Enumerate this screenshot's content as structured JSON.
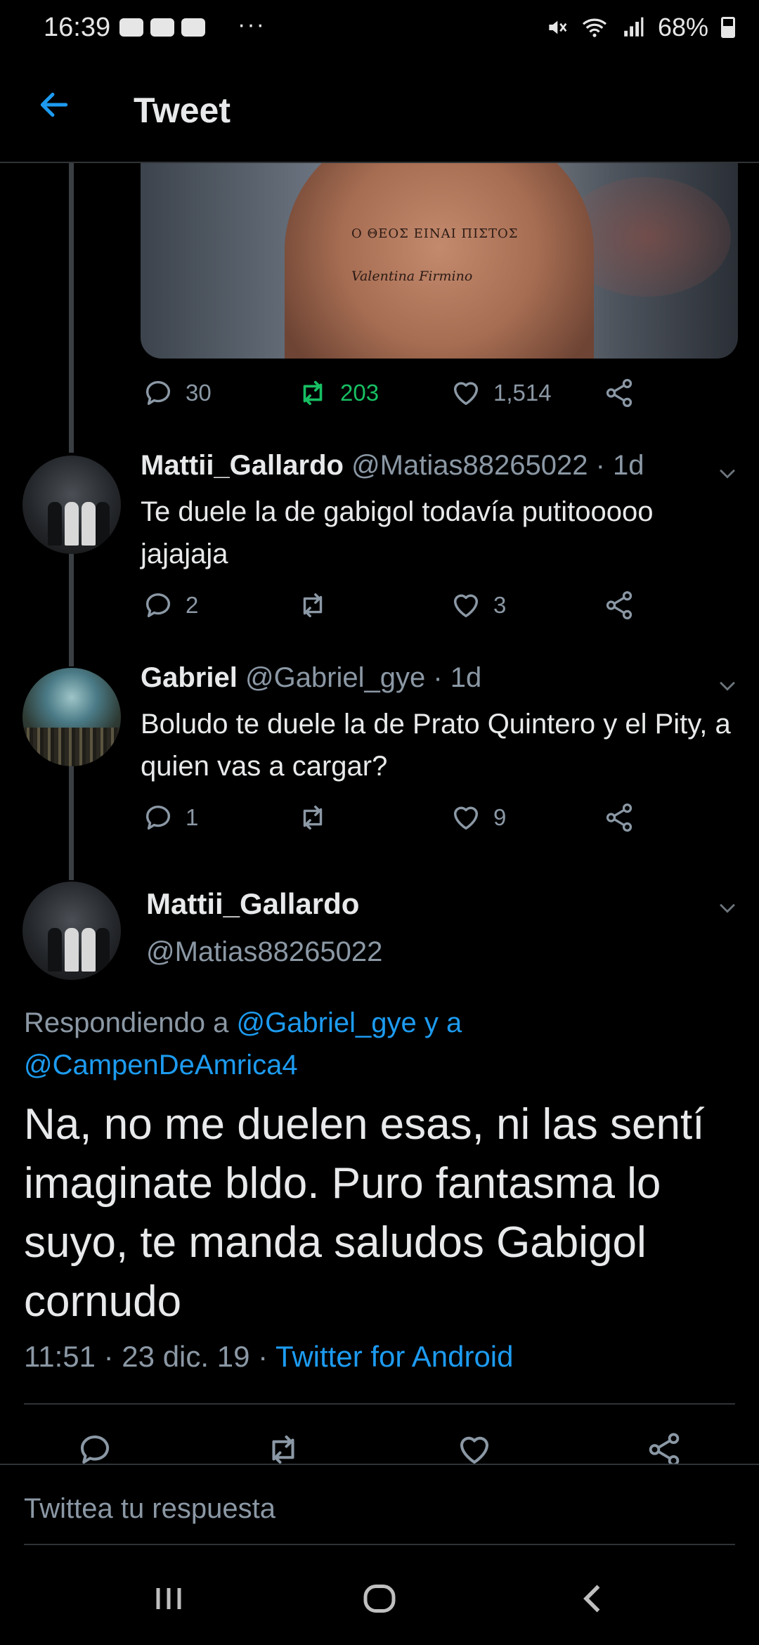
{
  "status_bar": {
    "time": "16:39",
    "more": "···",
    "battery": "68%",
    "icons": [
      "download-icon",
      "youtube-icon",
      "youtube-icon",
      "mute-icon",
      "wifi-icon",
      "signal-icon",
      "battery-icon"
    ]
  },
  "header": {
    "title": "Tweet",
    "back_icon": "arrow-left-icon"
  },
  "image_tweet": {
    "image_text_line1": "Ο ΘΕΟΣ ΕΙΝΑΙ ΠΙΣΤΟΣ",
    "image_text_line2": "Valentina Firmino",
    "actions": {
      "replies": "30",
      "retweets": "203",
      "likes": "1,514"
    }
  },
  "replies": [
    {
      "name": "Mattii_Gallardo",
      "meta": "@Matias88265022 · 1d",
      "text": "Te duele la de gabigol todavía putitooooo jajajaja",
      "replies": "2",
      "retweets": "",
      "likes": "3"
    },
    {
      "name": "Gabriel",
      "meta": "@Gabriel_gye · 1d",
      "text": "Boludo te duele la de Prato Quintero y el Pity, a quien vas a cargar?",
      "replies": "1",
      "retweets": "",
      "likes": "9"
    }
  ],
  "main_tweet": {
    "name": "Mattii_Gallardo",
    "handle": "@Matias88265022",
    "replying_prefix": "Respondiendo a ",
    "replying_mention1": "@Gabriel_gye y a",
    "replying_mention2": "@CampenDeAmrica4",
    "text": "Na, no me duelen esas, ni las sentí imaginate bldo. Puro fantasma lo suyo, te manda saludos Gabigol cornudo",
    "timestamp": "11:51 · 23 dic. 19 · ",
    "source": "Twitter for Android"
  },
  "reply_bar": {
    "placeholder": "Twittea tu respuesta"
  },
  "nav": {
    "icons": [
      "recents-icon",
      "home-icon",
      "back-icon"
    ]
  },
  "colors": {
    "background": "#000000",
    "link": "#1d9bf0",
    "retweet_active": "#17bf63",
    "muted": "#8b98a5",
    "divider": "#2f3336"
  }
}
